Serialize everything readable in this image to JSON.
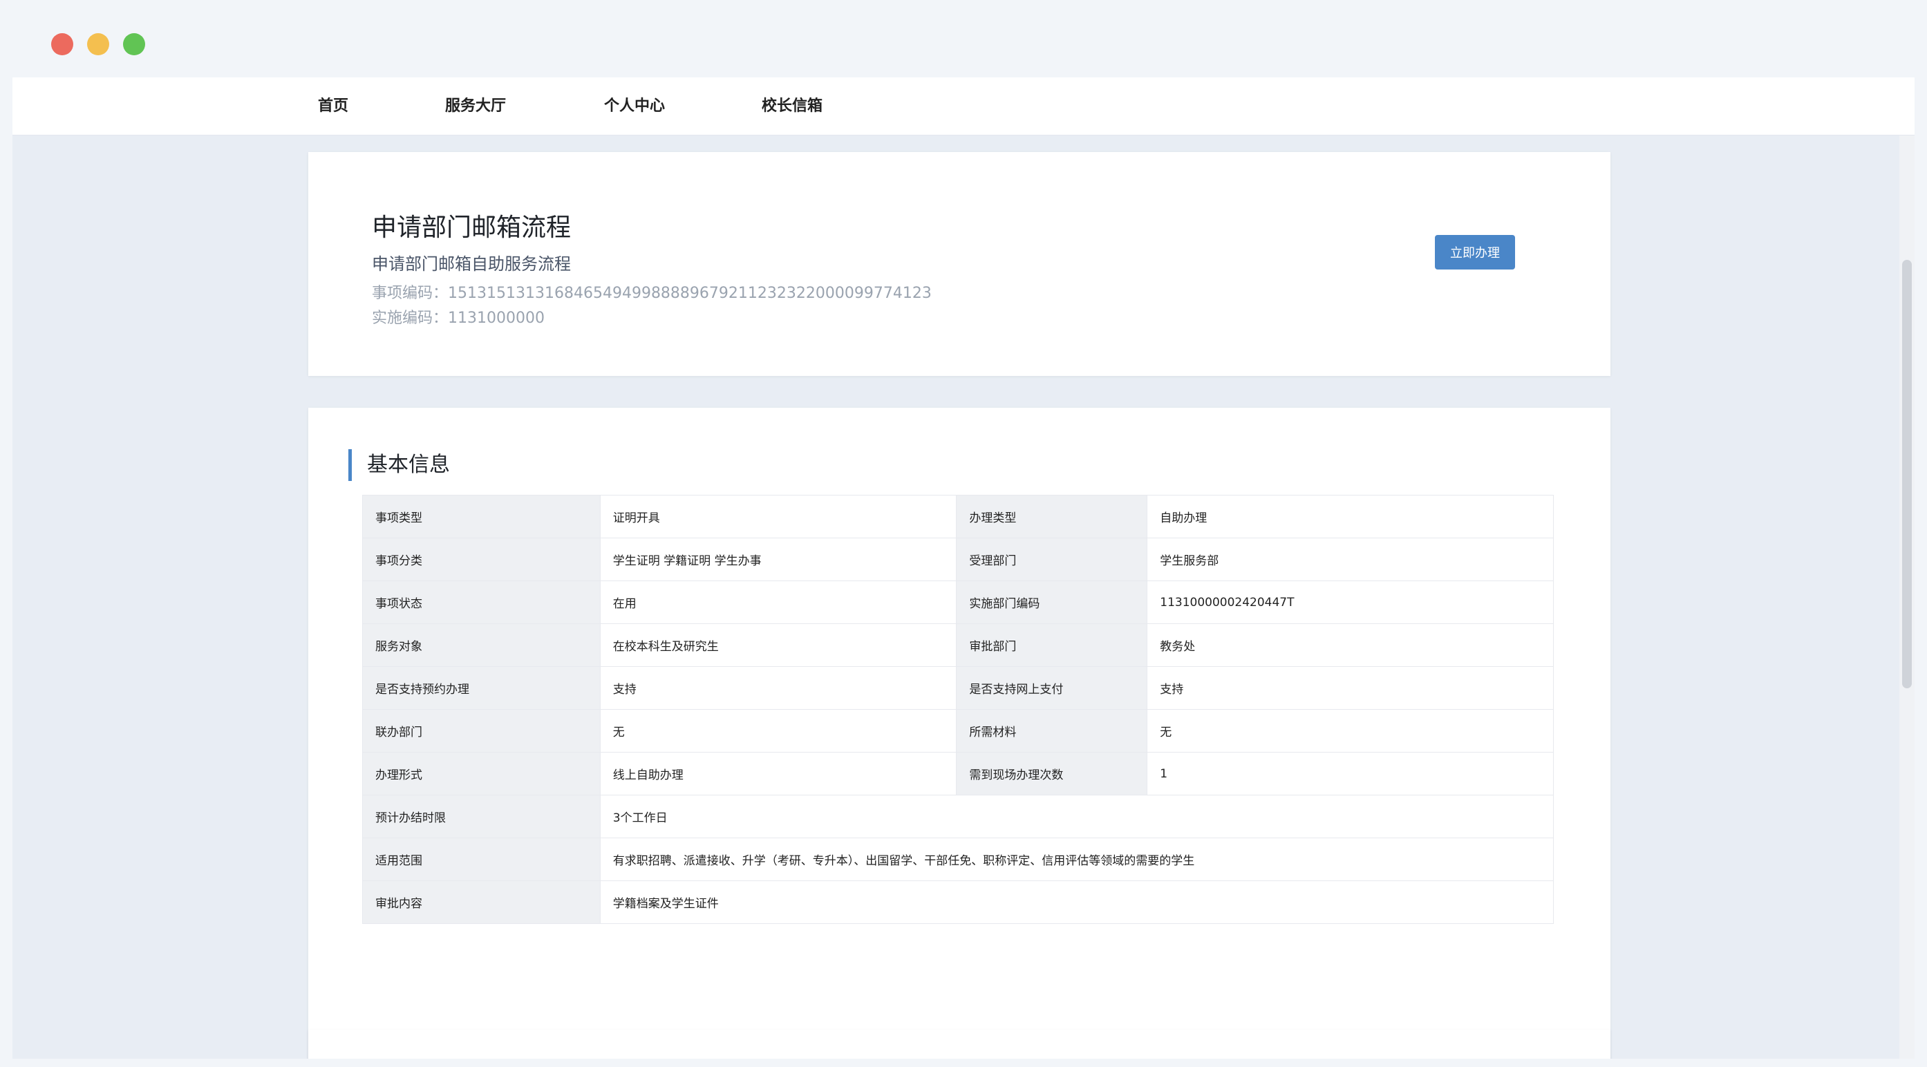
{
  "nav": {
    "items": [
      "首页",
      "服务大厅",
      "个人中心",
      "校长信箱"
    ]
  },
  "header": {
    "title": "申请部门邮箱流程",
    "subtitle": "申请部门邮箱自助服务流程",
    "item_code": "事项编码：15131513131684654949988889679211232322000099774123",
    "impl_code": "实施编码：1131000000",
    "apply_button": "立即办理"
  },
  "basic_info": {
    "title": "基本信息",
    "rows": [
      [
        "事项类型",
        "证明开具",
        "办理类型",
        "自助办理"
      ],
      [
        "事项分类",
        "学生证明 学籍证明 学生办事",
        "受理部门",
        "学生服务部"
      ],
      [
        "事项状态",
        "在用",
        "实施部门编码",
        "11310000002420447T"
      ],
      [
        "服务对象",
        "在校本科生及研究生",
        "审批部门",
        "教务处"
      ],
      [
        "是否支持预约办理",
        "支持",
        "是否支持网上支付",
        "支持"
      ],
      [
        "联办部门",
        "无",
        "所需材料",
        "无"
      ],
      [
        "办理形式",
        "线上自助办理",
        "需到现场办理次数",
        "1"
      ]
    ],
    "wide_rows": [
      [
        "预计办结时限",
        "3个工作日"
      ],
      [
        "适用范围",
        "有求职招聘、派遣接收、升学（考研、专升本）、出国留学、干部任免、职称评定、信用评估等领域的需要的学生"
      ],
      [
        "审批内容",
        "学籍档案及学生证件"
      ]
    ]
  },
  "colors": {
    "accent": "#4a86c8",
    "label_bg": "#eef0f3",
    "page_bg": "#e8edf4"
  }
}
